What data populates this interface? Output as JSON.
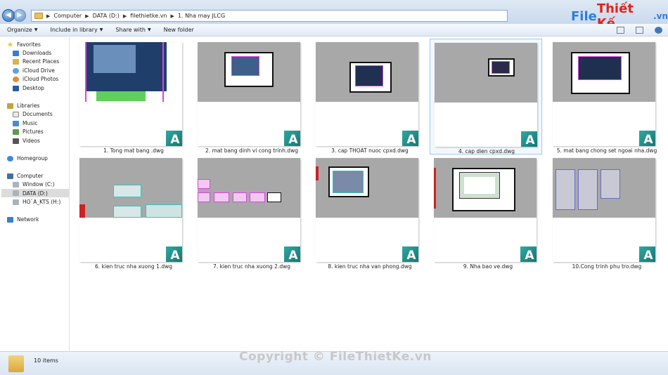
{
  "address": {
    "crumbs": [
      "Computer",
      "DATA (D:)",
      "filethietke.vn",
      "1. Nha may JLCG"
    ],
    "history_icon": "chevron-down-icon"
  },
  "logo": {
    "part1": "File",
    "part2": "Thiết Kế",
    "part3": ".vn"
  },
  "toolbar": {
    "organize": "Organize",
    "include": "Include in library",
    "share": "Share with",
    "new_folder": "New folder"
  },
  "sidebar": {
    "favorites": "Favorites",
    "fav_items": [
      "Downloads",
      "Recent Places",
      "iCloud Drive",
      "iCloud Photos",
      "Desktop"
    ],
    "libraries": "Libraries",
    "lib_items": [
      "Documents",
      "Music",
      "Pictures",
      "Videos"
    ],
    "homegroup": "Homegroup",
    "computer": "Computer",
    "drives": [
      "Window (C:)",
      "DATA (D:)",
      "HO`A_KTS (H:)"
    ],
    "network": "Network"
  },
  "files": [
    "1. Tong mat bang .dwg",
    "2. mat bang dinh vi cong trinh.dwg",
    "3. cap THOAT nuoc cpxd.dwg",
    "4. cap dien cpxd.dwg",
    "5. mat bang chong set ngoai nha.dwg",
    "6. kien truc nha xuong 1.dwg",
    "7. kien truc nha xuong 2.dwg",
    "8. kien truc nha van phong.dwg",
    "9. Nha bao ve.dwg",
    "10.Cong trinh phu tro.dwg"
  ],
  "file_icon_letter": "A",
  "selected_index": 3,
  "status": {
    "count": "10 items"
  },
  "watermark": "Copyright © FileThietKe.vn",
  "colors": {
    "accent": "#2b7fd6",
    "selection": "#99c9ef",
    "autocad": "#1f8a86"
  }
}
